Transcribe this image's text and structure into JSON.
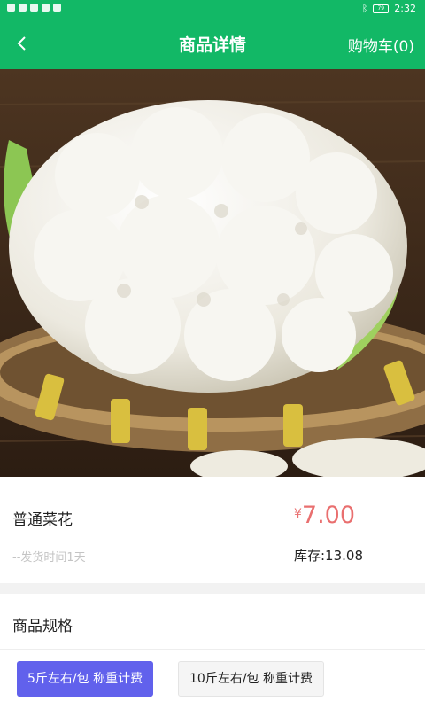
{
  "status_bar": {
    "time": "2:32",
    "battery": "79"
  },
  "header": {
    "title": "商品详情",
    "cart_link": "购物车(0)"
  },
  "product": {
    "name": "普通菜花",
    "currency": "¥",
    "price": "7.00",
    "ship_time": "--发货时间1天",
    "stock": "库存:13.08"
  },
  "spec": {
    "title": "商品规格",
    "options": [
      {
        "label": "5斤左右/包 称重计费",
        "selected": true
      },
      {
        "label": "10斤左右/包 称重计费",
        "selected": false
      }
    ]
  },
  "colors": {
    "brand": "#12b866",
    "price": "#e96f6f",
    "selected_chip": "#6161ec"
  }
}
